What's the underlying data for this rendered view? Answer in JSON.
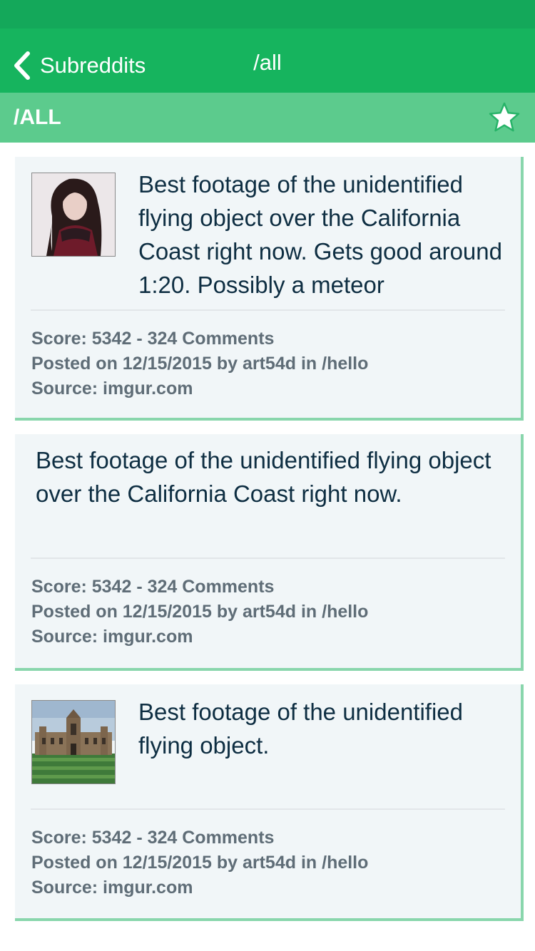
{
  "nav": {
    "back_label": "Subreddits",
    "title": "/all"
  },
  "subheader": {
    "title": "/ALL"
  },
  "colors": {
    "status_bar": "#14a85a",
    "nav_bar": "#16b45e",
    "sub_header": "#5ccb8d",
    "card_bg": "#f1f6f8",
    "card_accent": "#89d6ac"
  },
  "posts": [
    {
      "title": "Best footage of the unidentified flying object over the California Coast right now. Gets good around 1:20. Possibly a meteor",
      "score_line": "Score: 5342 - 324 Comments",
      "posted_line": "Posted on 12/15/2015 by art54d in /hello",
      "source_line": "Source: imgur.com",
      "thumbnail": "portrait-thumbnail"
    },
    {
      "title": "Best footage of the unidentified flying object over the California Coast right now.",
      "score_line": "Score: 5342 - 324 Comments",
      "posted_line": "Posted on 12/15/2015 by art54d in /hello",
      "source_line": "Source: imgur.com"
    },
    {
      "title": "Best footage of the unidentified flying object.",
      "score_line": "Score: 5342 - 324 Comments",
      "posted_line": "Posted on 12/15/2015 by art54d in /hello",
      "source_line": "Source: imgur.com",
      "thumbnail": "building-thumbnail"
    }
  ]
}
